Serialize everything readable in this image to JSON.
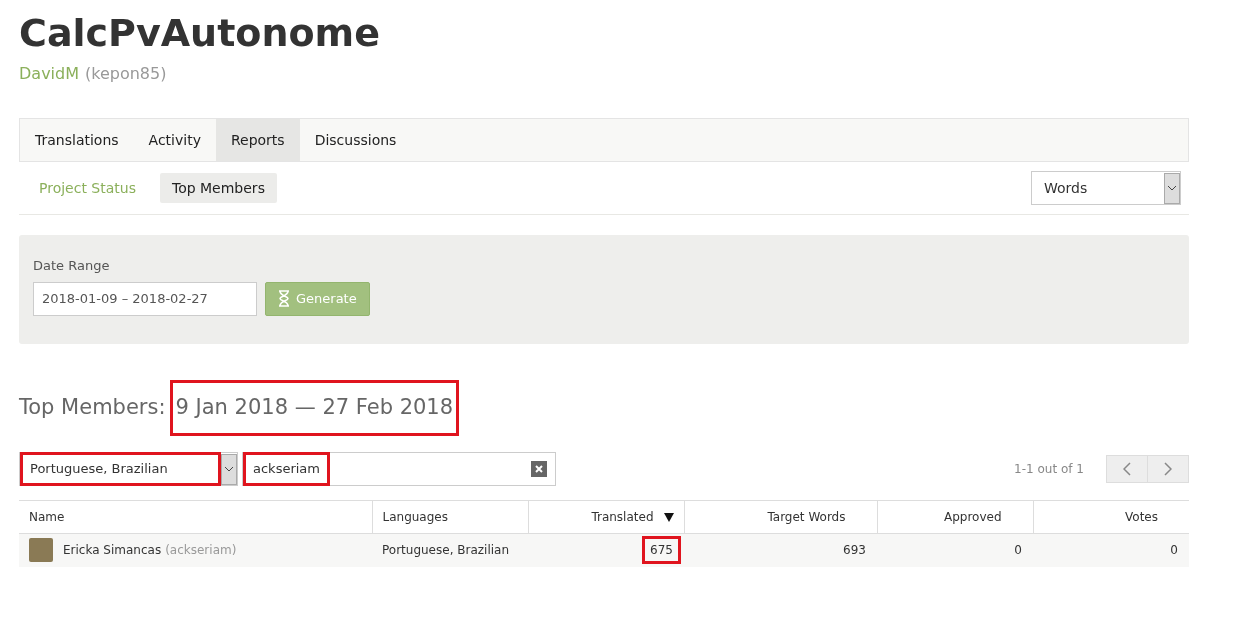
{
  "project": {
    "title": "CalcPvAutonome",
    "owner_name": "DavidM",
    "owner_handle": "(kepon85)"
  },
  "tabs": [
    {
      "label": "Translations",
      "selected": false
    },
    {
      "label": "Activity",
      "selected": false
    },
    {
      "label": "Reports",
      "selected": true
    },
    {
      "label": "Discussions",
      "selected": false
    }
  ],
  "subtabs": [
    {
      "label": "Project Status",
      "selected": false
    },
    {
      "label": "Top Members",
      "selected": true
    }
  ],
  "unit_select": {
    "value": "Words"
  },
  "date_range": {
    "label": "Date Range",
    "value": "2018-01-09 – 2018-02-27",
    "button": "Generate"
  },
  "report": {
    "heading": "Top Members:",
    "period": "9 Jan 2018 — 27 Feb 2018",
    "period_highlighted": true
  },
  "filters": {
    "language": {
      "value": "Portuguese, Brazilian",
      "highlighted": true
    },
    "search": {
      "value": "ackseriam",
      "highlighted": true
    },
    "pagination": "1-1 out of 1"
  },
  "table": {
    "columns": [
      {
        "label": "Name",
        "sorted": false
      },
      {
        "label": "Languages",
        "sorted": false
      },
      {
        "label": "Translated",
        "sorted": true
      },
      {
        "label": "Target Words",
        "sorted": false
      },
      {
        "label": "Approved",
        "sorted": false
      },
      {
        "label": "Votes",
        "sorted": false
      }
    ],
    "rows": [
      {
        "name": "Ericka Simancas",
        "handle": "(ackseriam)",
        "languages": "Portuguese, Brazilian",
        "translated": "675",
        "translated_highlighted": true,
        "target_words": "693",
        "approved": "0",
        "votes": "0"
      }
    ]
  }
}
